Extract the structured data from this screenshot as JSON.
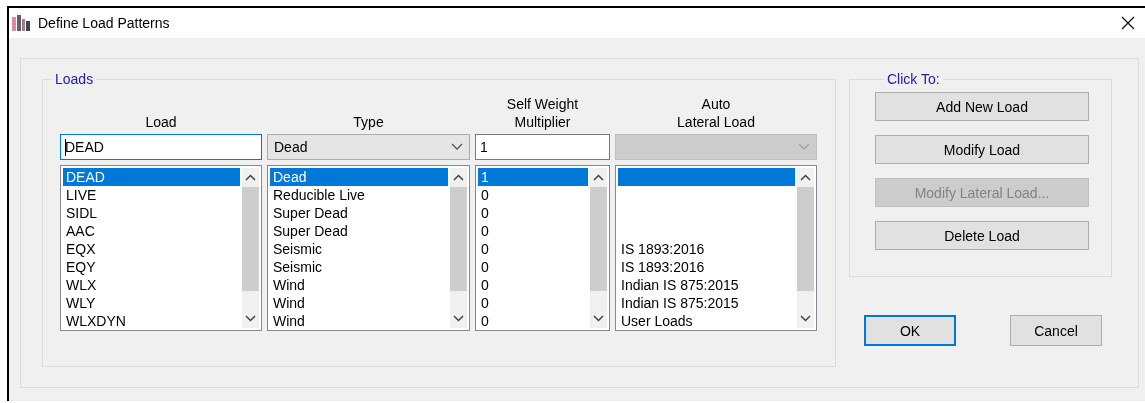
{
  "window": {
    "title": "Define Load Patterns"
  },
  "loads": {
    "legend": "Loads",
    "columns": [
      {
        "kind": "text",
        "header": [
          "Load"
        ],
        "field": {
          "value": "DEAD",
          "focused": true
        },
        "rows": [
          {
            "text": "DEAD",
            "selected": true
          },
          {
            "text": "LIVE",
            "selected": false
          },
          {
            "text": "SIDL",
            "selected": false
          },
          {
            "text": "AAC",
            "selected": false
          },
          {
            "text": "EQX",
            "selected": false
          },
          {
            "text": "EQY",
            "selected": false
          },
          {
            "text": "WLX",
            "selected": false
          },
          {
            "text": "WLY",
            "selected": false
          },
          {
            "text": "WLXDYN",
            "selected": false
          }
        ]
      },
      {
        "kind": "combo",
        "header": [
          "Type"
        ],
        "field": {
          "value": "Dead",
          "disabled": false
        },
        "rows": [
          {
            "text": "Dead",
            "selected": true
          },
          {
            "text": "Reducible Live",
            "selected": false
          },
          {
            "text": "Super Dead",
            "selected": false
          },
          {
            "text": "Super Dead",
            "selected": false
          },
          {
            "text": "Seismic",
            "selected": false
          },
          {
            "text": "Seismic",
            "selected": false
          },
          {
            "text": "Wind",
            "selected": false
          },
          {
            "text": "Wind",
            "selected": false
          },
          {
            "text": "Wind",
            "selected": false
          }
        ]
      },
      {
        "kind": "text",
        "header": [
          "Self Weight",
          "Multiplier"
        ],
        "field": {
          "value": "1",
          "focused": false
        },
        "rows": [
          {
            "text": "1",
            "selected": true
          },
          {
            "text": "0",
            "selected": false
          },
          {
            "text": "0",
            "selected": false
          },
          {
            "text": "0",
            "selected": false
          },
          {
            "text": "0",
            "selected": false
          },
          {
            "text": "0",
            "selected": false
          },
          {
            "text": "0",
            "selected": false
          },
          {
            "text": "0",
            "selected": false
          },
          {
            "text": "0",
            "selected": false
          }
        ]
      },
      {
        "kind": "combo",
        "header": [
          "Auto",
          "Lateral Load"
        ],
        "field": {
          "disabled": true
        },
        "rows": [
          {
            "selected": true
          },
          {
            "selected": false
          },
          {
            "selected": false
          },
          {
            "selected": false
          },
          {
            "text": "IS 1893:2016",
            "selected": false
          },
          {
            "text": "IS 1893:2016",
            "selected": false
          },
          {
            "text": "Indian IS 875:2015",
            "selected": false
          },
          {
            "text": "Indian IS 875:2015",
            "selected": false
          },
          {
            "text": "User Loads",
            "selected": false
          }
        ]
      }
    ]
  },
  "actions": {
    "legend": "Click To:",
    "buttons": [
      {
        "label": "Add New Load",
        "disabled": false
      },
      {
        "label": "Modify Load",
        "disabled": false
      },
      {
        "label": "Modify Lateral Load...",
        "disabled": true
      },
      {
        "label": "Delete Load",
        "disabled": false
      }
    ]
  },
  "dialog_buttons": [
    {
      "label": "OK",
      "default": true
    },
    {
      "label": "Cancel",
      "default": false
    }
  ]
}
